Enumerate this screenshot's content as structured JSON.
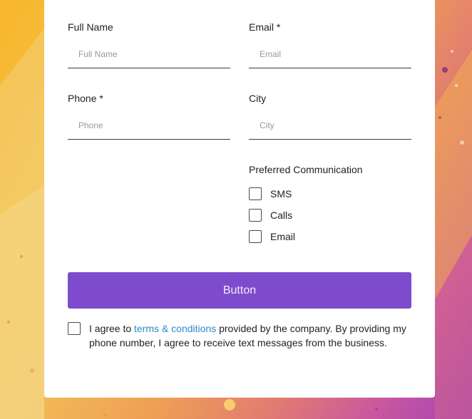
{
  "form": {
    "full_name": {
      "label": "Full Name",
      "placeholder": "Full Name",
      "value": ""
    },
    "email": {
      "label": "Email *",
      "placeholder": "Email",
      "value": ""
    },
    "phone": {
      "label": "Phone *",
      "placeholder": "Phone",
      "value": ""
    },
    "city": {
      "label": "City",
      "placeholder": "City",
      "value": ""
    },
    "preferred_communication": {
      "title": "Preferred Communication",
      "options": [
        {
          "label": "SMS",
          "checked": false
        },
        {
          "label": "Calls",
          "checked": false
        },
        {
          "label": "Email",
          "checked": false
        }
      ]
    },
    "submit_label": "Button",
    "agreement": {
      "prefix": "I agree to ",
      "link_text": "terms & conditions",
      "suffix": " provided by the company. By providing my phone number, I agree to receive text messages from the business.",
      "checked": false
    }
  },
  "colors": {
    "button": "#7e4bcc",
    "link": "#2f8bc9",
    "card": "#ffffff"
  }
}
